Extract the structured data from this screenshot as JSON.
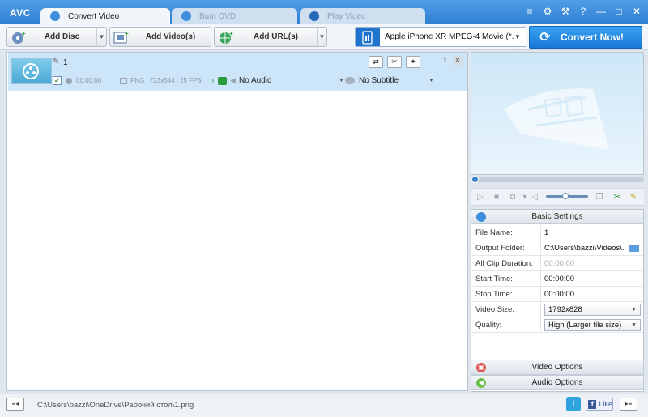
{
  "app": {
    "logo": "AVC"
  },
  "tabs": [
    {
      "label": "Convert Video",
      "active": true,
      "icon": "convert-video-icon"
    },
    {
      "label": "Burn DVD",
      "active": false,
      "icon": "burn-dvd-icon"
    },
    {
      "label": "Play Video",
      "active": false,
      "icon": "play-video-icon"
    }
  ],
  "window_controls": [
    "menu-icon",
    "settings-icon",
    "tools-icon",
    "help-icon",
    "minimize-icon",
    "maximize-icon",
    "close-icon"
  ],
  "window_glyphs": {
    "menu": "≡",
    "settings": "⚙",
    "tools": "⚒",
    "help": "?",
    "minimize": "—",
    "maximize": "□",
    "close": "✕"
  },
  "toolbar": {
    "add_disc": "Add Disc",
    "add_videos": "Add Video(s)",
    "add_urls": "Add URL(s)",
    "profile": "Apple iPhone XR MPEG-4 Movie (*.m...",
    "convert": "Convert Now!"
  },
  "file_item": {
    "name": "1",
    "duration": "00:00:00",
    "info": "PNG | 723x544 | 25 FPS",
    "audio": "No Audio",
    "subtitle": "No Subtitle",
    "checked": true
  },
  "settings": {
    "title": "Basic Settings",
    "rows": [
      {
        "label": "File Name:",
        "value": "1",
        "type": "text"
      },
      {
        "label": "Output Folder:",
        "value": "C:\\Users\\bazzi\\Videos\\...",
        "type": "folder"
      },
      {
        "label": "All Clip Duration:",
        "value": "00:00:00",
        "type": "muted"
      },
      {
        "label": "Start Time:",
        "value": "00:00:00",
        "type": "text"
      },
      {
        "label": "Stop Time:",
        "value": "00:00:00",
        "type": "text"
      },
      {
        "label": "Video Size:",
        "value": "1792x828",
        "type": "select"
      },
      {
        "label": "Quality:",
        "value": "High (Larger file size)",
        "type": "select"
      }
    ],
    "video_options": "Video Options",
    "audio_options": "Audio Options"
  },
  "status": {
    "path": "C:\\Users\\bazzi\\OneDrive\\Рабочий стол\\1.png",
    "like": "Like"
  },
  "colors": {
    "accent": "#2f7fd2",
    "convert_button": "#1877d6",
    "selected_item": "#cde5f9"
  }
}
